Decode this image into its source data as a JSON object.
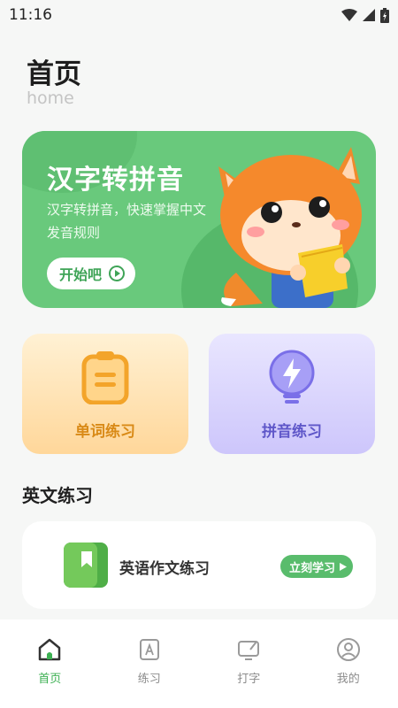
{
  "status_bar": {
    "time": "11:16",
    "icons": [
      "wifi-icon",
      "signal-icon",
      "battery-icon"
    ]
  },
  "header": {
    "title": "首页",
    "subtitle": "home"
  },
  "banner": {
    "title": "汉字转拼音",
    "description": "汉字转拼音，快速掌握中文发音规则",
    "button_label": "开始吧",
    "colors": {
      "background": "#69c97c",
      "button_text": "#3fa457"
    }
  },
  "cards": [
    {
      "label": "单词练习",
      "icon": "clipboard-icon",
      "color": "#d98a17"
    },
    {
      "label": "拼音练习",
      "icon": "lightbulb-icon",
      "color": "#5f57c9"
    }
  ],
  "section": {
    "title": "英文练习"
  },
  "lesson": {
    "title": "英语作文练习",
    "button_label": "立刻学习",
    "icon": "book-icon"
  },
  "tabbar": {
    "active_color": "#3cb052",
    "items": [
      {
        "label": "首页",
        "icon": "home-icon",
        "active": true
      },
      {
        "label": "练习",
        "icon": "practice-book-icon",
        "active": false
      },
      {
        "label": "打字",
        "icon": "typing-edit-icon",
        "active": false
      },
      {
        "label": "我的",
        "icon": "profile-icon",
        "active": false
      }
    ]
  }
}
